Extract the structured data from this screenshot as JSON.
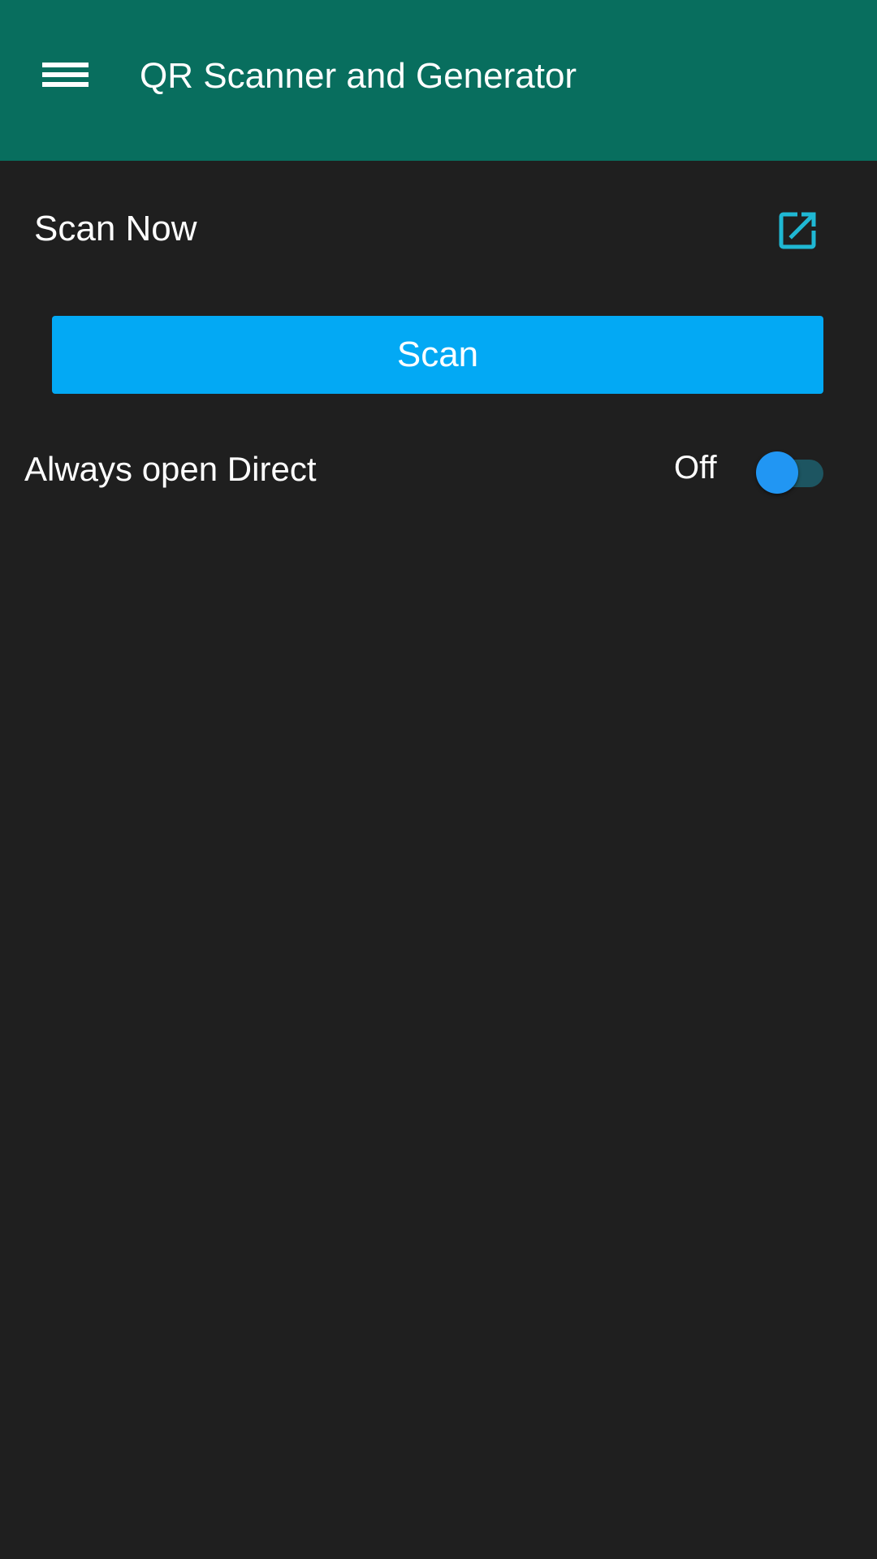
{
  "app_bar": {
    "title": "QR Scanner and Generator",
    "menu_icon": "hamburger-menu-icon",
    "background_color": "#086e5e"
  },
  "scan_now": {
    "label": "Scan Now",
    "action_icon": "open-in-new-icon",
    "icon_color": "#1fb8d4"
  },
  "scan_button": {
    "label": "Scan",
    "color": "#03a9f4"
  },
  "always_open_direct": {
    "label": "Always open Direct",
    "state_label": "Off",
    "checked": false
  },
  "theme": {
    "background": "#1f1f1f"
  }
}
